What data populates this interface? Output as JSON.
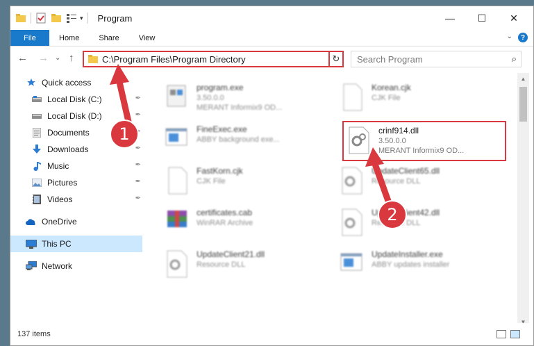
{
  "window": {
    "title": "Program",
    "minimize": "—",
    "maximize": "☐",
    "close": "✕"
  },
  "ribbon": {
    "tabs": [
      "File",
      "Home",
      "Share",
      "View"
    ],
    "help": "?",
    "collapse": "⌄"
  },
  "address": {
    "path": "C:\\Program Files\\Program Directory",
    "dropdown": "⌄",
    "refresh": "↻"
  },
  "search": {
    "placeholder": "Search Program",
    "icon": "search-icon"
  },
  "nav": {
    "back": "←",
    "forward": "→",
    "recent": "⌄",
    "up": "↑",
    "items": [
      {
        "label": "Quick access",
        "icon": "star-icon"
      },
      {
        "label": "Local Disk (C:)",
        "icon": "drive-icon",
        "pinned": true
      },
      {
        "label": "Local Disk (D:)",
        "icon": "drive-icon",
        "pinned": true
      },
      {
        "label": "Documents",
        "icon": "documents-icon",
        "pinned": true
      },
      {
        "label": "Downloads",
        "icon": "download-icon",
        "pinned": true
      },
      {
        "label": "Music",
        "icon": "music-icon",
        "pinned": true
      },
      {
        "label": "Pictures",
        "icon": "pictures-icon",
        "pinned": true
      },
      {
        "label": "Videos",
        "icon": "videos-icon",
        "pinned": true
      },
      {
        "label": "OneDrive",
        "icon": "cloud-icon"
      },
      {
        "label": "This PC",
        "icon": "computer-icon",
        "selected": true
      },
      {
        "label": "Network",
        "icon": "network-icon"
      }
    ],
    "pin_glyph": "📌"
  },
  "files": [
    {
      "name": "program.exe",
      "line2": "3.50.0.0",
      "line3": "MERANT Informix9 OD...",
      "icon": "exe-icon"
    },
    {
      "name": "Korean.cjk",
      "line2": "CJK File",
      "line3": "",
      "icon": "file-icon"
    },
    {
      "name": "FineExec.exe",
      "line2": "ABBY background exe...",
      "line3": "",
      "icon": "exe-icon"
    },
    {
      "name": "crinf914.dll",
      "line2": "3.50.0.0",
      "line3": "MERANT Informix9 OD...",
      "icon": "dll-gear-icon",
      "highlighted": true
    },
    {
      "name": "FastKorn.cjk",
      "line2": "CJK File",
      "line3": "",
      "icon": "file-icon"
    },
    {
      "name": "UpdateClient65.dll",
      "line2": "Resource DLL",
      "line3": "",
      "icon": "dll-gear-icon"
    },
    {
      "name": "certificates.cab",
      "line2": "WinRAR Archive",
      "line3": "",
      "icon": "archive-icon"
    },
    {
      "name": "UpdateClient42.dll",
      "line2": "Resource DLL",
      "line3": "",
      "icon": "dll-gear-icon"
    },
    {
      "name": "UpdateClient21.dll",
      "line2": "Resource DLL",
      "line3": "",
      "icon": "dll-gear-icon"
    },
    {
      "name": "UpdateInstaller.exe",
      "line2": "ABBY updates installer",
      "line3": "",
      "icon": "exe-icon"
    }
  ],
  "status": {
    "count": "137 items"
  },
  "callouts": [
    "1",
    "2"
  ],
  "colors": {
    "accent": "#1979ca",
    "highlight": "#d8383e",
    "selection": "#cce8ff"
  }
}
